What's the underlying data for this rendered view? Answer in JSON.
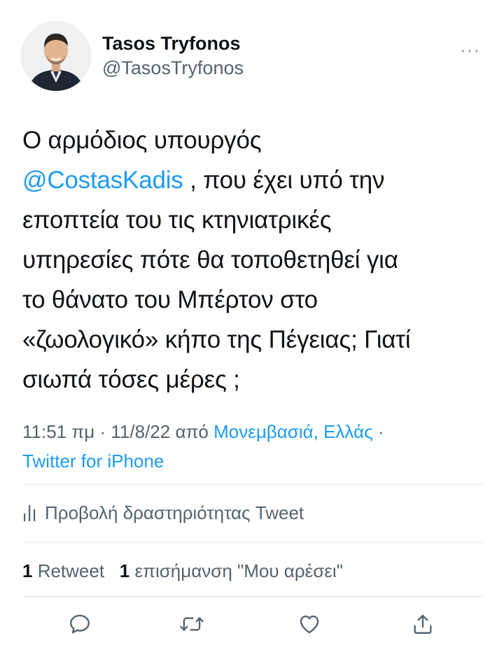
{
  "author": {
    "display_name": "Tasos Tryfonos",
    "handle": "@TasosTryfonos"
  },
  "more_label": "···",
  "body": {
    "line1": "Ο αρμόδιος υπουργός",
    "mention": "@CostasKadis",
    "line2_rest": " , που έχει υπό την",
    "line3": "εποπτεία του τις κτηνιατρικές",
    "line4": "υπηρεσίες πότε θα τοποθετηθεί για",
    "line5": "το θάνατο του Μπέρτον στο",
    "line6": "«ζωολογικό» κήπο της Πέγειας; Γιατί",
    "line7": "σιωπά τόσες μέρες ;"
  },
  "meta": {
    "time": "11:51 πμ",
    "separator": " · ",
    "date": "11/8/22",
    "from_word": " από ",
    "location": "Μονεμβασιά, Ελλάς",
    "trailing_separator": " ·",
    "source": "Twitter for iPhone"
  },
  "activity": {
    "label": "Προβολή δραστηριότητας Tweet",
    "icon": "bar-chart-icon"
  },
  "counts": {
    "retweets_count": "1",
    "retweets_label": " Retweet",
    "likes_count": "1",
    "likes_label": " επισήμανση \"Μου αρέσει\""
  },
  "actions": {
    "reply_icon": "reply-icon",
    "retweet_icon": "retweet-icon",
    "like_icon": "heart-icon",
    "share_icon": "share-icon"
  },
  "colors": {
    "link": "#1d9bf0",
    "text": "#0f1419",
    "secondary": "#536471",
    "divider": "#dfe3e7"
  }
}
